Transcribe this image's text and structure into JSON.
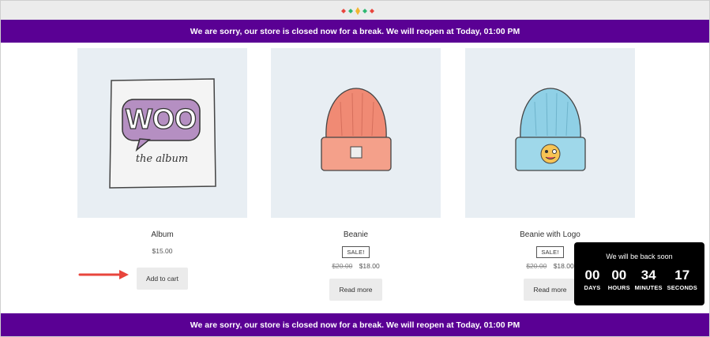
{
  "notice": {
    "text": "We are sorry, our store is closed now for a break. We will reopen at Today, 01:00 PM"
  },
  "products": [
    {
      "name": "Album",
      "price": "$15.00",
      "button": "Add to cart",
      "thumb_text_top": "WOO",
      "thumb_text_bottom": "the album"
    },
    {
      "name": "Beanie",
      "sale_badge": "SALE!",
      "old_price": "$20.00",
      "price": "$18.00",
      "button": "Read more"
    },
    {
      "name": "Beanie with Logo",
      "sale_badge": "SALE!",
      "old_price": "$20.00",
      "price": "$18.00",
      "button": "Read more"
    }
  ],
  "countdown": {
    "title": "We will be back soon",
    "days": "00",
    "days_label": "DAYS",
    "hours": "00",
    "hours_label": "HOURS",
    "minutes": "34",
    "minutes_label": "MINUTES",
    "seconds": "17",
    "seconds_label": "SECONDS"
  },
  "colors": {
    "notice_bg": "#5a0094",
    "thumb_bg": "#e8eef3",
    "arrow": "#e8453c",
    "countdown_bg": "#000000"
  },
  "icons": {
    "site_logo": "colored-diamonds-logo",
    "pointer": "red-arrow-icon"
  }
}
